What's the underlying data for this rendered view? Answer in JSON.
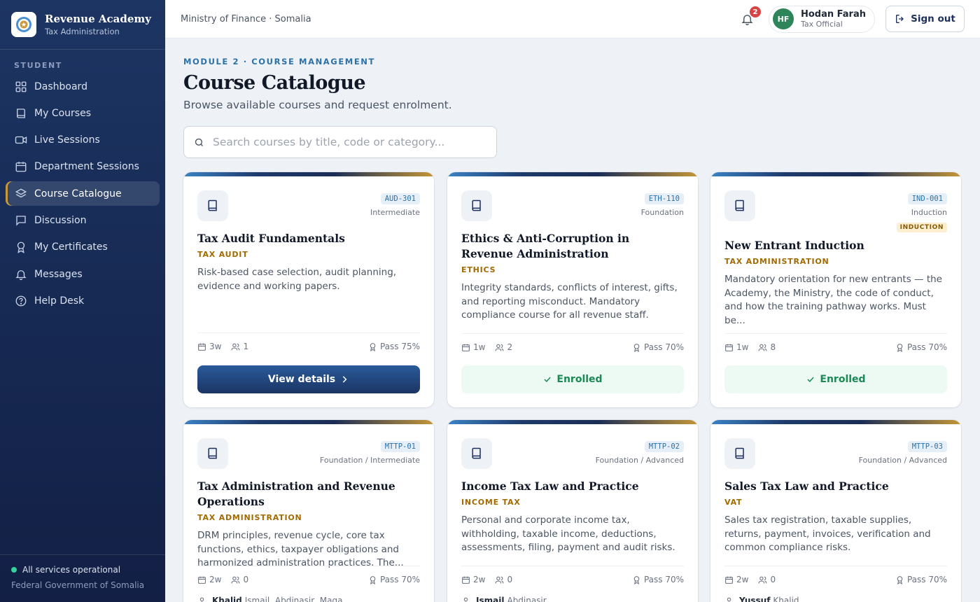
{
  "app": {
    "title": "Revenue Academy",
    "subtitle": "Tax Administration"
  },
  "sidebar": {
    "section_label": "STUDENT",
    "items": [
      {
        "label": "Dashboard",
        "icon": "grid-icon",
        "active": false
      },
      {
        "label": "My Courses",
        "icon": "book-icon",
        "active": false
      },
      {
        "label": "Live Sessions",
        "icon": "video-icon",
        "active": false
      },
      {
        "label": "Department Sessions",
        "icon": "calendar-icon",
        "active": false
      },
      {
        "label": "Course Catalogue",
        "icon": "layers-icon",
        "active": true
      },
      {
        "label": "Discussion",
        "icon": "chat-icon",
        "active": false
      },
      {
        "label": "My Certificates",
        "icon": "award-icon",
        "active": false
      },
      {
        "label": "Messages",
        "icon": "bell-icon",
        "active": false
      },
      {
        "label": "Help Desk",
        "icon": "help-icon",
        "active": false
      }
    ],
    "footer": {
      "status": "All services operational",
      "government": "Federal Government of Somalia"
    }
  },
  "topbar": {
    "breadcrumb": "Ministry of Finance · Somalia",
    "notification_count": "2",
    "user": {
      "initials": "HF",
      "name": "Hodan Farah",
      "role": "Tax Official"
    },
    "signout_label": "Sign out"
  },
  "page": {
    "eyebrow": "MODULE 2 · COURSE MANAGEMENT",
    "title": "Course Catalogue",
    "subtitle": "Browse available courses and request enrolment.",
    "search_placeholder": "Search courses by title, code or category..."
  },
  "courses": [
    {
      "code": "AUD-301",
      "level": "Intermediate",
      "tag": "",
      "title": "Tax Audit Fundamentals",
      "category": "TAX AUDIT",
      "description": "Risk-based case selection, audit planning, evidence and working papers.",
      "duration": "3w",
      "learners": "1",
      "pass": "Pass 75%",
      "action": "View details",
      "enrolled": false
    },
    {
      "code": "ETH-110",
      "level": "Foundation",
      "tag": "",
      "title": "Ethics & Anti-Corruption in Revenue Administration",
      "category": "ETHICS",
      "description": "Integrity standards, conflicts of interest, gifts, and reporting misconduct. Mandatory compliance course for all revenue staff.",
      "duration": "1w",
      "learners": "2",
      "pass": "Pass 70%",
      "action": "Enrolled",
      "enrolled": true
    },
    {
      "code": "IND-001",
      "level": "Induction",
      "tag": "INDUCTION",
      "title": "New Entrant Induction",
      "category": "TAX ADMINISTRATION",
      "description": "Mandatory orientation for new entrants — the Academy, the Ministry, the code of conduct, and how the training pathway works. Must be...",
      "duration": "1w",
      "learners": "8",
      "pass": "Pass 70%",
      "action": "Enrolled",
      "enrolled": true
    },
    {
      "code": "MTTP-01",
      "level": "Foundation / Intermediate",
      "tag": "",
      "title": "Tax Administration and Revenue Operations",
      "category": "TAX ADMINISTRATION",
      "description": "DRM principles, revenue cycle, core tax functions, ethics, taxpayer obligations and harmonized administration practices. The...",
      "duration": "2w",
      "learners": "0",
      "pass": "Pass 70%",
      "instructor_lead": "Khalid",
      "instructor_rest": "Ismail, Abdinasir, Maga"
    },
    {
      "code": "MTTP-02",
      "level": "Foundation / Advanced",
      "tag": "",
      "title": "Income Tax Law and Practice",
      "category": "INCOME TAX",
      "description": "Personal and corporate income tax, withholding, taxable income, deductions, assessments, filing, payment and audit risks.",
      "duration": "2w",
      "learners": "0",
      "pass": "Pass 70%",
      "instructor_lead": "Ismail",
      "instructor_rest": "Abdinasir"
    },
    {
      "code": "MTTP-03",
      "level": "Foundation / Advanced",
      "tag": "",
      "title": "Sales Tax Law and Practice",
      "category": "VAT",
      "description": "Sales tax registration, taxable supplies, returns, payment, invoices, verification and common compliance risks.",
      "duration": "2w",
      "learners": "0",
      "pass": "Pass 70%",
      "instructor_lead": "Yussuf",
      "instructor_rest": "Khalid"
    }
  ]
}
